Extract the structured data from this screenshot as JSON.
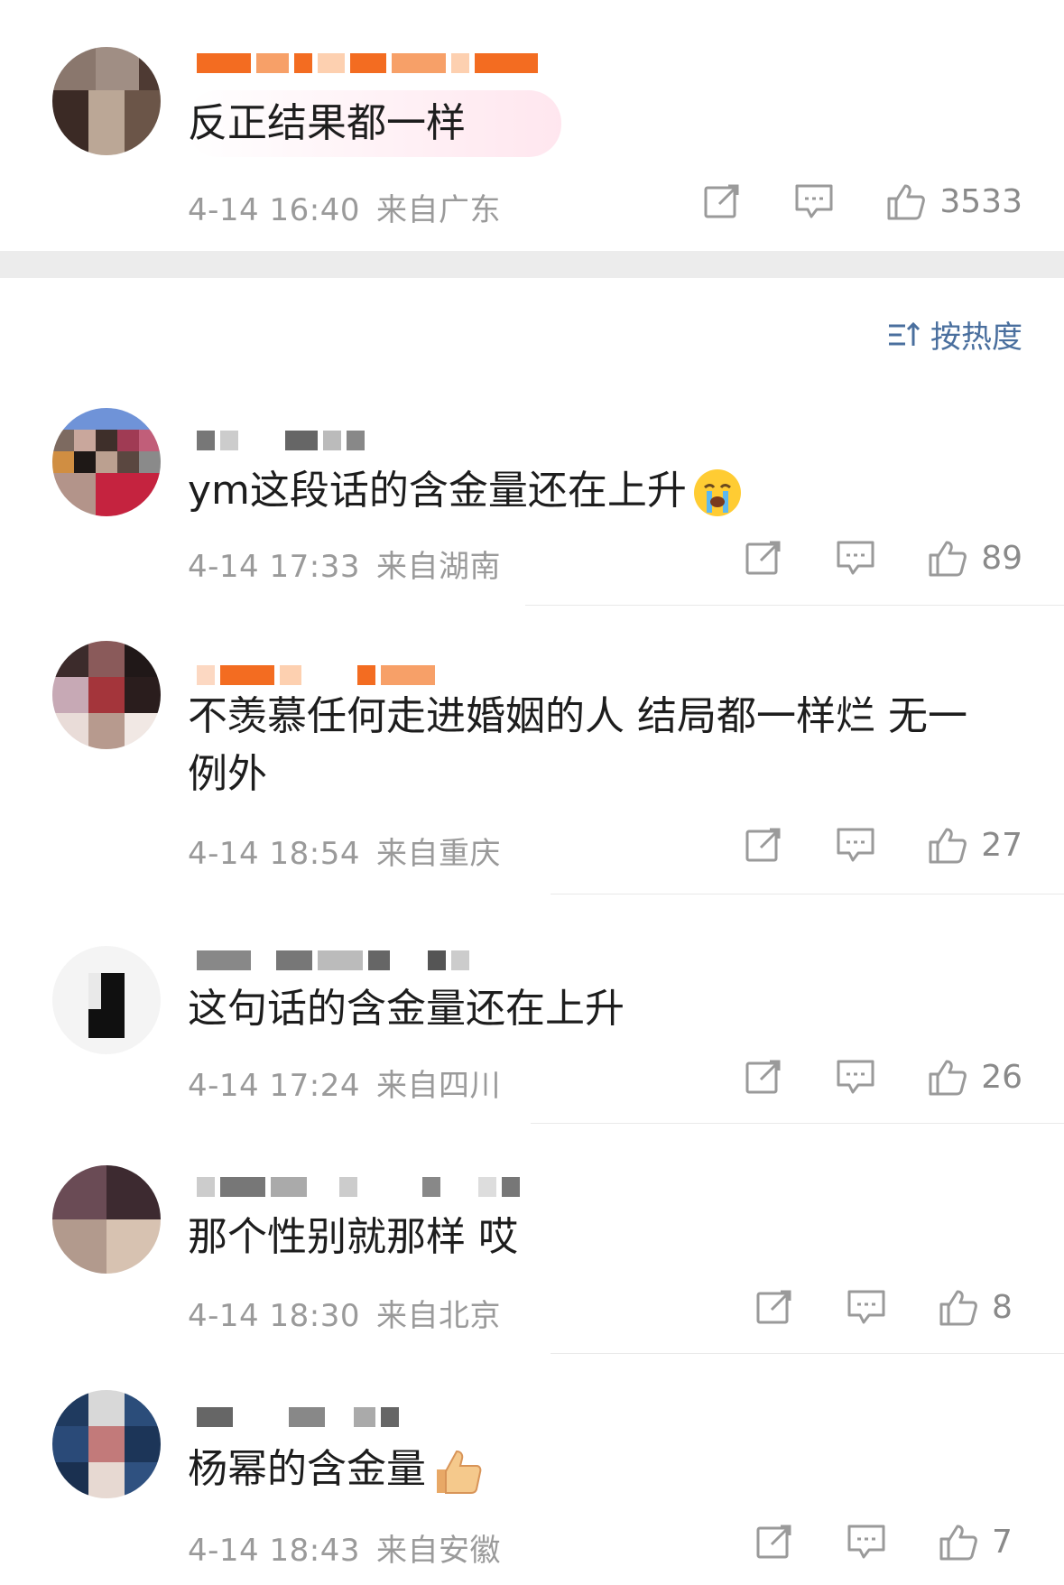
{
  "sort": {
    "label": "按热度"
  },
  "comments": [
    {
      "text": "反正结果都一样",
      "time": "4-14 16:40",
      "location": "来自广东",
      "likes": "3533"
    },
    {
      "text": "ym这段话的含金量还在上升",
      "time": "4-14 17:33",
      "location": "来自湖南",
      "likes": "89"
    },
    {
      "text": "不羡慕任何走进婚姻的人 结局都一样烂 无一例外",
      "time": "4-14 18:54",
      "location": "来自重庆",
      "likes": "27"
    },
    {
      "text": "这句话的含金量还在上升",
      "time": "4-14 17:24",
      "location": "来自四川",
      "likes": "26"
    },
    {
      "text": "那个性别就那样 哎",
      "time": "4-14 18:30",
      "location": "来自北京",
      "likes": "8"
    },
    {
      "text": "杨幂的含金量",
      "time": "4-14 18:43",
      "location": "来自安徽",
      "likes": "7"
    }
  ],
  "icons": {
    "repost": "repost-icon",
    "comment": "comment-icon",
    "like": "thumbs-up-icon",
    "sort": "sort-icon",
    "crying_emoji": "crying-emoji-icon",
    "thumb_emoji": "thumbs-up-emoji-icon"
  },
  "colors": {
    "accent_blue": "#4a6f9e",
    "meta_gray": "#9a9a9a",
    "name_orange": "#f36c21"
  }
}
